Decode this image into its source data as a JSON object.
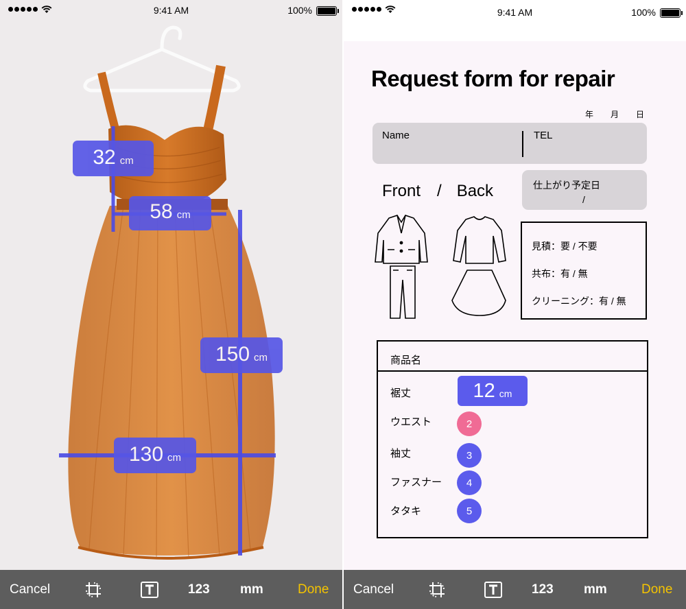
{
  "status_bar": {
    "time": "9:41 AM",
    "battery": "100%"
  },
  "toolbar": {
    "cancel": "Cancel",
    "numeric": "123",
    "unit": "mm",
    "done": "Done",
    "crop_icon": "crop-rotate-icon",
    "text_icon": "text-box-icon"
  },
  "measurements": [
    {
      "value": "32",
      "unit": "cm"
    },
    {
      "value": "58",
      "unit": "cm"
    },
    {
      "value": "150",
      "unit": "cm"
    },
    {
      "value": "130",
      "unit": "cm"
    }
  ],
  "form": {
    "title": "Request form for repair",
    "date": {
      "year": "年",
      "month": "月",
      "day": "日"
    },
    "name_label": "Name",
    "tel_label": "TEL",
    "due_label": "仕上がり予定日",
    "due_separator": "/",
    "front": "Front",
    "slash": "/",
    "back": "Back",
    "options": [
      "見積：要 / 不要",
      "共布：有 / 無",
      "クリーニング：有 / 無"
    ],
    "product_label": "商品名",
    "rows": [
      {
        "label": "裾丈",
        "marker": ""
      },
      {
        "label": "ウエスト",
        "marker": "2"
      },
      {
        "label": "袖丈",
        "marker": "3"
      },
      {
        "label": "ファスナー",
        "marker": "4"
      },
      {
        "label": "タタキ",
        "marker": "5"
      }
    ],
    "hem_measure": {
      "value": "12",
      "unit": "cm"
    }
  },
  "colors": {
    "accent": "#5656e6",
    "pink": "#f06b95",
    "done": "#f5c400",
    "dress": "#d8772a"
  }
}
